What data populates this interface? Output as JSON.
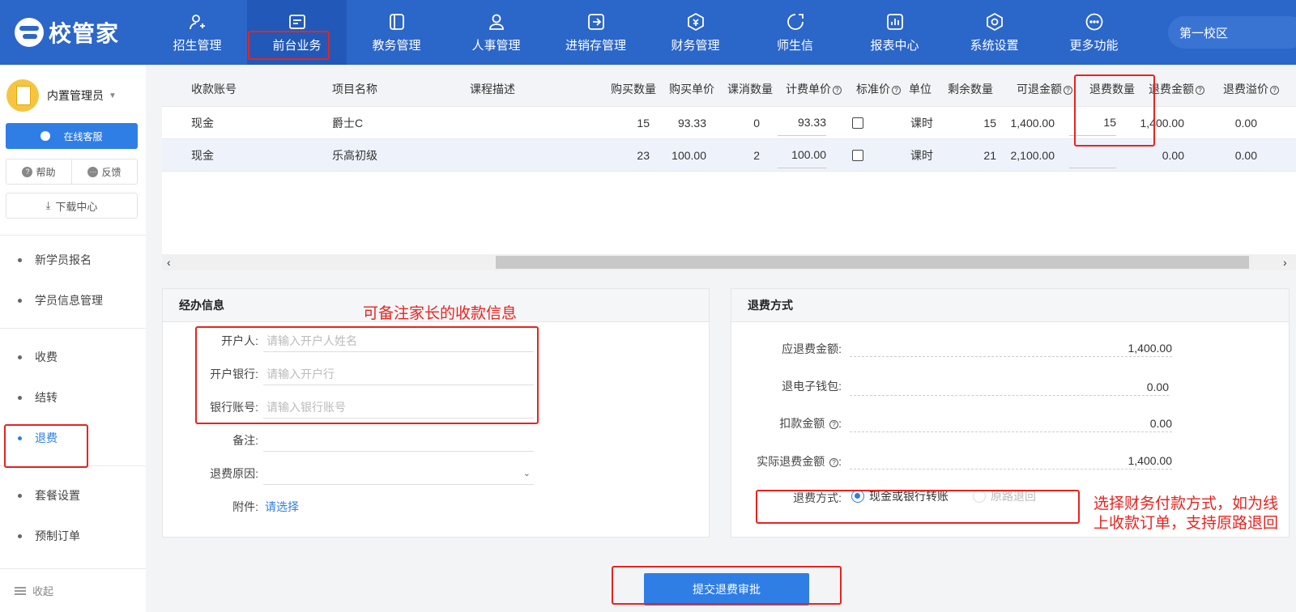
{
  "app": {
    "logo_text": "校管家"
  },
  "nav": [
    {
      "label": "招生管理",
      "icon": "user-plus-icon"
    },
    {
      "label": "前台业务",
      "icon": "desk-icon"
    },
    {
      "label": "教务管理",
      "icon": "book-icon"
    },
    {
      "label": "人事管理",
      "icon": "person-icon"
    },
    {
      "label": "进销存管理",
      "icon": "box-arrow-icon"
    },
    {
      "label": "财务管理",
      "icon": "money-icon"
    },
    {
      "label": "师生信",
      "icon": "chat-icon"
    },
    {
      "label": "报表中心",
      "icon": "chart-icon"
    },
    {
      "label": "系统设置",
      "icon": "settings-icon"
    },
    {
      "label": "更多功能",
      "icon": "more-icon"
    }
  ],
  "campus": "第一校区",
  "sidebar": {
    "user_name": "内置管理员",
    "online_service": "在线客服",
    "help": "帮助",
    "feedback": "反馈",
    "download": "下载中心",
    "items": [
      "新学员报名",
      "学员信息管理",
      "收费",
      "结转",
      "退费",
      "套餐设置",
      "预制订单"
    ],
    "active": "退费",
    "collapse": "收起"
  },
  "table": {
    "headers": [
      "收款账号",
      "项目名称",
      "课程描述",
      "购买数量",
      "购买单价",
      "课消数量",
      "计费单价",
      "标准价",
      "单位",
      "剩余数量",
      "可退金额",
      "退费数量",
      "退费金额",
      "退费溢价"
    ],
    "rows": [
      {
        "account": "现金",
        "item": "爵士C",
        "desc": "",
        "buy_qty": "15",
        "buy_price": "93.33",
        "used_qty": "0",
        "bill_price": "93.33",
        "std": false,
        "unit": "课时",
        "remain": "15",
        "refundable": "1,400.00",
        "refund_qty": "15",
        "refund_amt": "1,400.00",
        "premium": "0.00"
      },
      {
        "account": "现金",
        "item": "乐高初级",
        "desc": "",
        "buy_qty": "23",
        "buy_price": "100.00",
        "used_qty": "2",
        "bill_price": "100.00",
        "std": false,
        "unit": "课时",
        "remain": "21",
        "refundable": "2,100.00",
        "refund_qty": "",
        "refund_amt": "0.00",
        "premium": "0.00"
      }
    ]
  },
  "handler": {
    "title": "经办信息",
    "account_holder_label": "开户人:",
    "account_holder_placeholder": "请输入开户人姓名",
    "bank_label": "开户银行:",
    "bank_placeholder": "请输入开户行",
    "account_no_label": "银行账号:",
    "account_no_placeholder": "请输入银行账号",
    "remark_label": "备注:",
    "reason_label": "退费原因:",
    "attachment_label": "附件:",
    "attachment_link": "请选择"
  },
  "refund": {
    "title": "退费方式",
    "due_label": "应退费金额:",
    "due_value": "1,400.00",
    "wallet_label": "退电子钱包:",
    "wallet_value": "0.00",
    "deduct_label": "扣款金额",
    "deduct_value": "0.00",
    "actual_label": "实际退费金额",
    "actual_value": "1,400.00",
    "method_label": "退费方式:",
    "method_option1": "现金或银行转账",
    "method_option2": "原路退回"
  },
  "submit_label": "提交退费审批",
  "annotations": {
    "note1": "可备注家长的收款信息",
    "note2": "选择财务付款方式，如为线上收款订单，支持原路退回"
  },
  "colors": {
    "primary": "#2b66c9",
    "accent": "#2f7ee6",
    "annotation": "#e8231f"
  }
}
